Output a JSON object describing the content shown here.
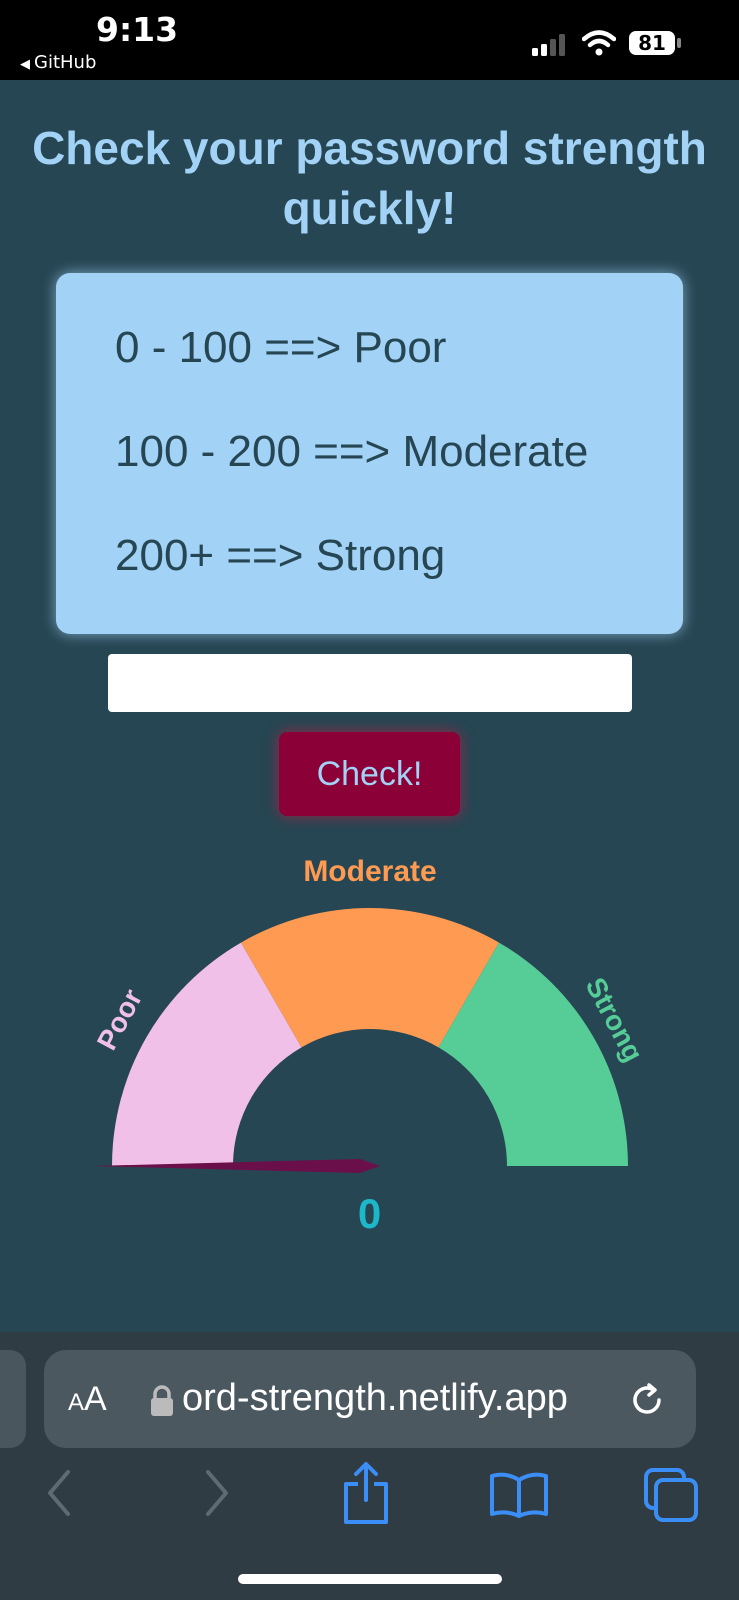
{
  "status_bar": {
    "time": "9:13",
    "back_app": "GitHub",
    "battery": "81"
  },
  "page": {
    "title_line1": "Check your password strength",
    "title_line2": "quickly!"
  },
  "ranges": [
    "0 - 100 ==> Poor",
    "100 - 200 ==> Moderate",
    "200+ ==> Strong"
  ],
  "password_input": {
    "value": "",
    "placeholder": ""
  },
  "check_button": {
    "label": "Check!"
  },
  "gauge": {
    "labels": {
      "poor": "Poor",
      "moderate": "Moderate",
      "strong": "Strong"
    },
    "colors": {
      "poor": "#f0c0e8",
      "moderate": "#ff9a52",
      "strong": "#56cc96",
      "needle": "#6b0f4a"
    },
    "value": 0,
    "score_text": "0"
  },
  "browser": {
    "aa_label_small": "A",
    "aa_label_large": "A",
    "url": "ord-strength.netlify.app"
  },
  "icons": {
    "status": [
      "cellular-signal-icon",
      "wifi-icon",
      "battery-icon"
    ],
    "toolbar": [
      "back-arrow-icon",
      "forward-arrow-icon",
      "share-icon",
      "bookmarks-icon",
      "tabs-icon"
    ]
  }
}
